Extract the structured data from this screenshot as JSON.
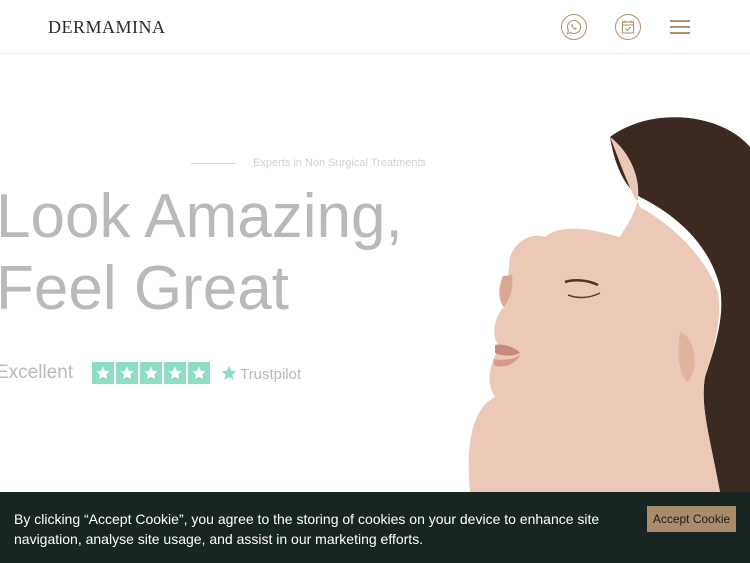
{
  "header": {
    "logo": "DERMAMINA",
    "icons": [
      "whatsapp-icon",
      "calendar-icon",
      "menu-icon"
    ]
  },
  "hero": {
    "eyebrow": "Experts in Non Surgical Treatments",
    "headline_line1": "Look Amazing,",
    "headline_line2": "Feel Great",
    "rating_label": "Excellent",
    "rating_stars": 5,
    "rating_brand": "Trustpilot"
  },
  "cookie": {
    "text": "By clicking “Accept Cookie”, you agree to the storing of cookies on your device to enhance site navigation, analyse site usage, and assist in our marketing efforts.",
    "accept_label": "Accept Cookie"
  },
  "colors": {
    "accent": "#b3916d",
    "cookie_bg": "#182520",
    "cookie_button": "#a88c6b",
    "trustpilot_green": "#8edcc4"
  }
}
